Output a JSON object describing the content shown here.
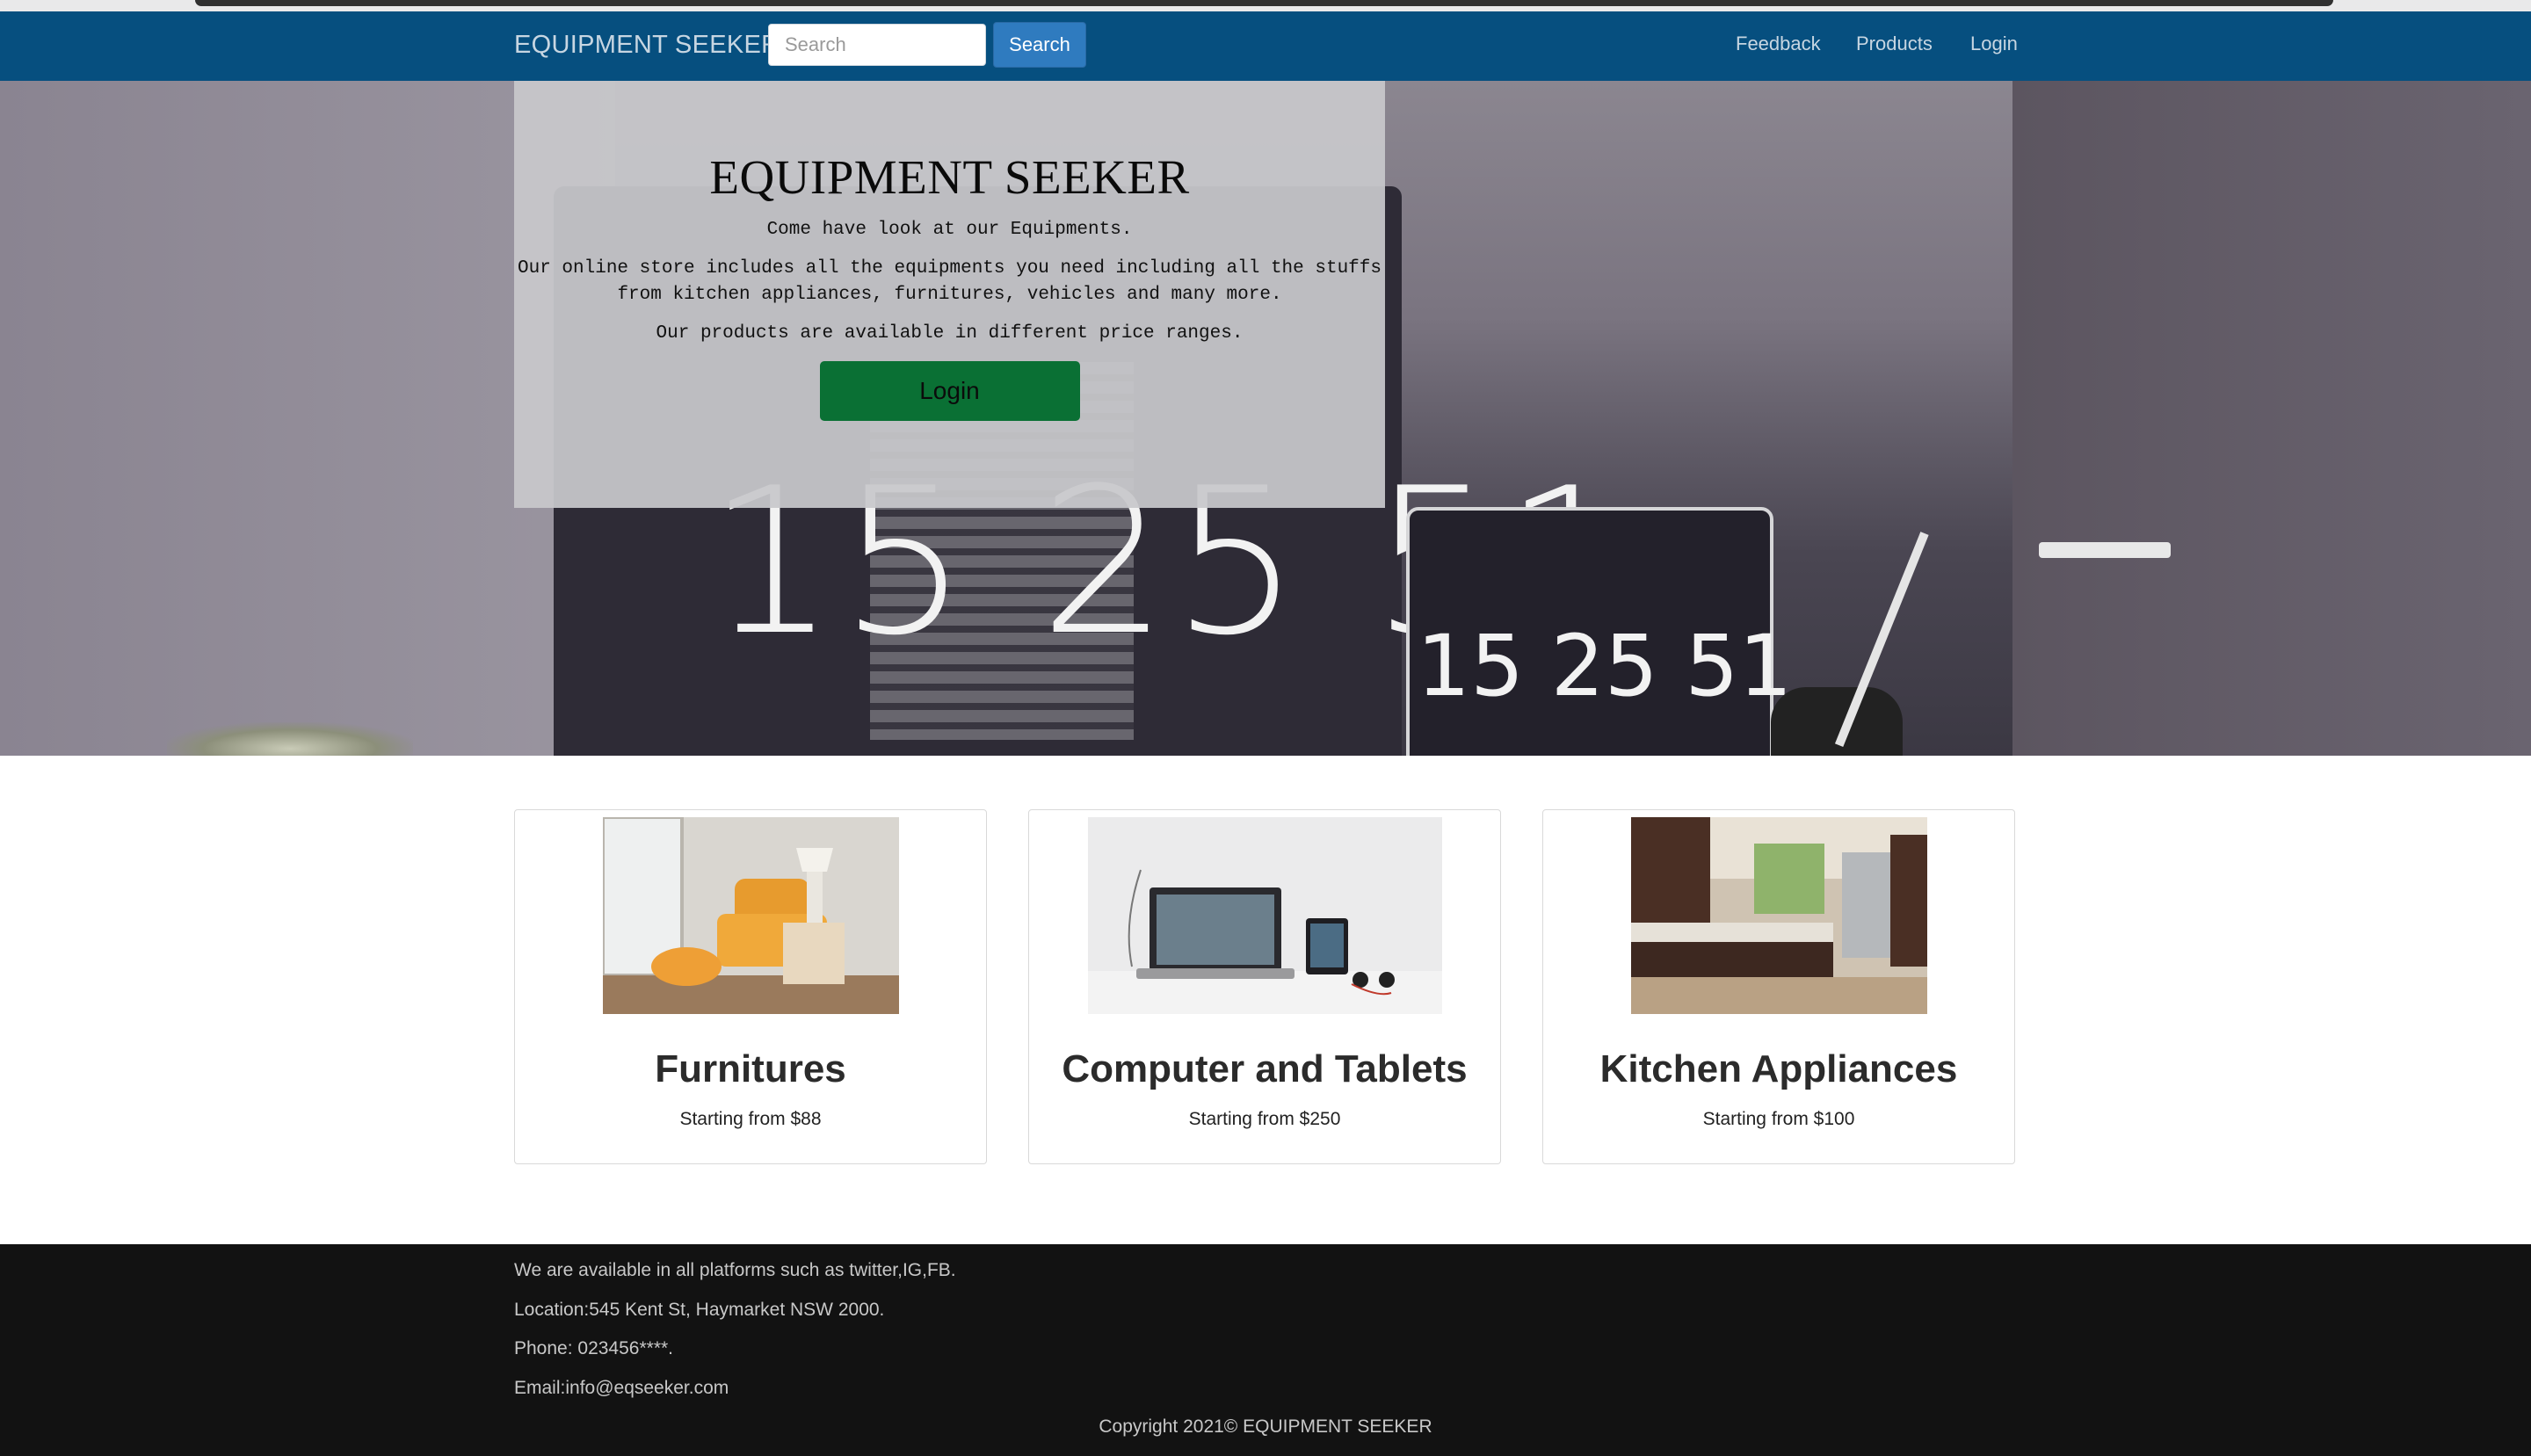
{
  "navbar": {
    "brand": "EQUIPMENT SEEKER",
    "search_placeholder": "Search",
    "search_button": "Search",
    "links": [
      "Feedback",
      "Products",
      "Login"
    ]
  },
  "hero": {
    "title": "EQUIPMENT SEEKER",
    "line1": "Come have look at our Equipments.",
    "line2": "Our online store includes all the equipments you need including all the stuffs from kitchen appliances, furnitures, vehicles and many more.",
    "line3": "Our products are available in different price ranges.",
    "login_button": "Login",
    "clock_big": "15 25 51",
    "clock_small": "15 25 51"
  },
  "products": [
    {
      "title": "Furnitures",
      "subtitle": "Starting from $88"
    },
    {
      "title": "Computer and Tablets",
      "subtitle": "Starting from $250"
    },
    {
      "title": "Kitchen Appliances",
      "subtitle": "Starting from $100"
    }
  ],
  "footer": {
    "platforms": "We are available in all platforms such as twitter,IG,FB.",
    "location": "Location:545 Kent St, Haymarket NSW 2000.",
    "phone": "Phone: 023456****.",
    "email": "Email:info@eqseeker.com",
    "copyright": "Copyright 2021© EQUIPMENT SEEKER"
  },
  "colors": {
    "navbar": "#064f7f",
    "search_button": "#2f7bbf",
    "login_cta": "#0a7034",
    "footer": "#121212"
  }
}
